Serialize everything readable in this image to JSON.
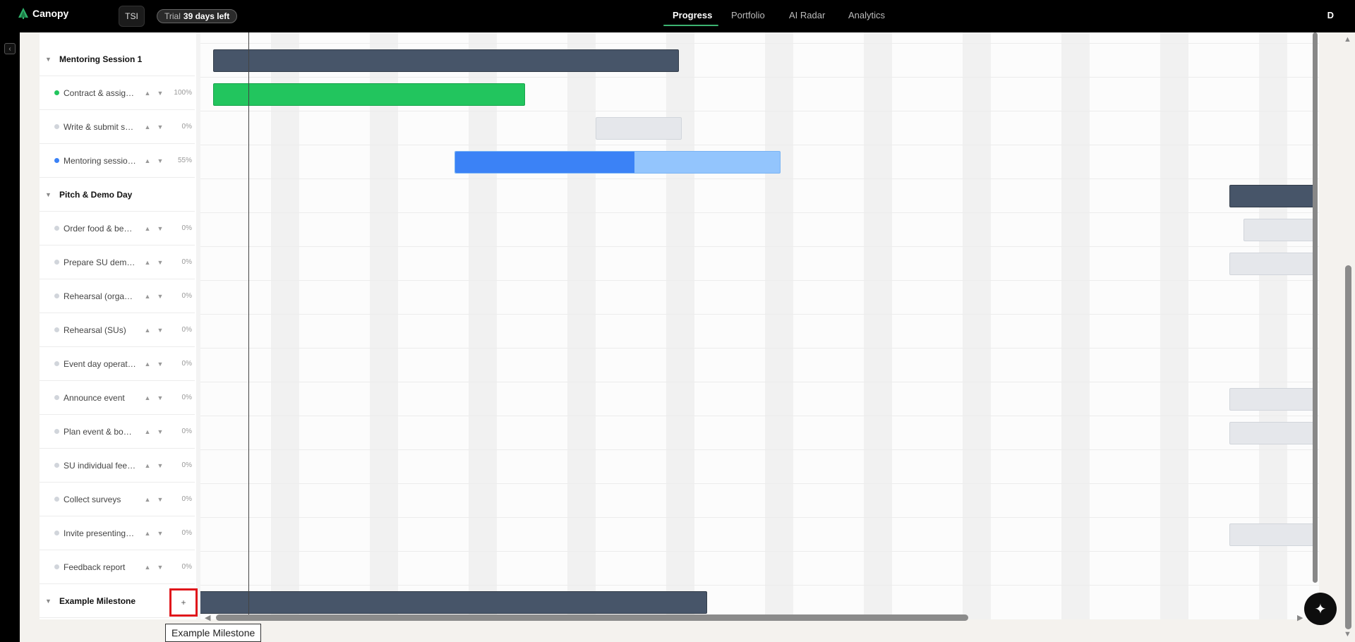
{
  "app": {
    "name": "Canopy",
    "logo_icon": "tree-icon"
  },
  "workspace": {
    "label": "TSI"
  },
  "trial": {
    "prefix": "Trial",
    "days": "39 days left"
  },
  "nav": {
    "tabs": [
      {
        "label": "Progress",
        "active": true
      },
      {
        "label": "Portfolio",
        "active": false
      },
      {
        "label": "AI Radar",
        "active": false
      },
      {
        "label": "Analytics",
        "active": false
      }
    ]
  },
  "user": {
    "initial": "D"
  },
  "sidebar_toggle": {
    "icon": "chevron-left-icon",
    "glyph": "‹"
  },
  "rows": [
    {
      "type": "milestone",
      "label": "Mentoring Session 1"
    },
    {
      "type": "task",
      "label": "Contract & assignment",
      "status": "done",
      "percent": "100%"
    },
    {
      "type": "task",
      "label": "Write & submit session plan",
      "status": "todo",
      "percent": "0%"
    },
    {
      "type": "task",
      "label": "Mentoring sessions",
      "status": "progress",
      "percent": "55%"
    },
    {
      "type": "milestone",
      "label": "Pitch & Demo Day"
    },
    {
      "type": "task",
      "label": "Order food & beverages",
      "status": "todo",
      "percent": "0%"
    },
    {
      "type": "task",
      "label": "Prepare SU demo booths",
      "status": "todo",
      "percent": "0%"
    },
    {
      "type": "task",
      "label": "Rehearsal (organizers)",
      "status": "todo",
      "percent": "0%"
    },
    {
      "type": "task",
      "label": "Rehearsal (SUs)",
      "status": "todo",
      "percent": "0%"
    },
    {
      "type": "task",
      "label": "Event day operations",
      "status": "todo",
      "percent": "0%"
    },
    {
      "type": "task",
      "label": "Announce event",
      "status": "todo",
      "percent": "0%"
    },
    {
      "type": "task",
      "label": "Plan event & book venue",
      "status": "todo",
      "percent": "0%"
    },
    {
      "type": "task",
      "label": "SU individual feedback",
      "status": "todo",
      "percent": "0%"
    },
    {
      "type": "task",
      "label": "Collect surveys",
      "status": "todo",
      "percent": "0%"
    },
    {
      "type": "task",
      "label": "Invite presenting SUs",
      "status": "todo",
      "percent": "0%"
    },
    {
      "type": "task",
      "label": "Feedback report",
      "status": "todo",
      "percent": "0%"
    },
    {
      "type": "milestone",
      "label": "Example Milestone"
    }
  ],
  "add_button": {
    "glyph": "+",
    "icon": "plus-icon"
  },
  "tooltip": {
    "text": "Example Milestone"
  },
  "fab": {
    "icon": "sparkle-icon",
    "glyph": "✦"
  },
  "colors": {
    "done": "#22c55e",
    "progress": "#3b82f6",
    "todo": "#d1d5db",
    "milestone_bar": "#475569",
    "highlight": "#e0161b"
  }
}
